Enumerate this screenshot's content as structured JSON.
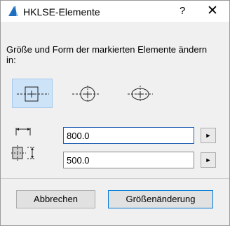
{
  "window": {
    "title": "HKLSE-Elemente",
    "help_label": "?",
    "close_label": "✕"
  },
  "description": "Größe und Form der markierten Elemente ändern in:",
  "shapes": [
    {
      "icon": "rectangle-shape-icon",
      "selected": true
    },
    {
      "icon": "circle-shape-icon",
      "selected": false
    },
    {
      "icon": "ellipse-shape-icon",
      "selected": false
    }
  ],
  "width_field": {
    "value": "800.0"
  },
  "height_field": {
    "value": "500.0"
  },
  "arrow_label": "►",
  "buttons": {
    "cancel": "Abbrechen",
    "resize": "Größenänderung"
  }
}
